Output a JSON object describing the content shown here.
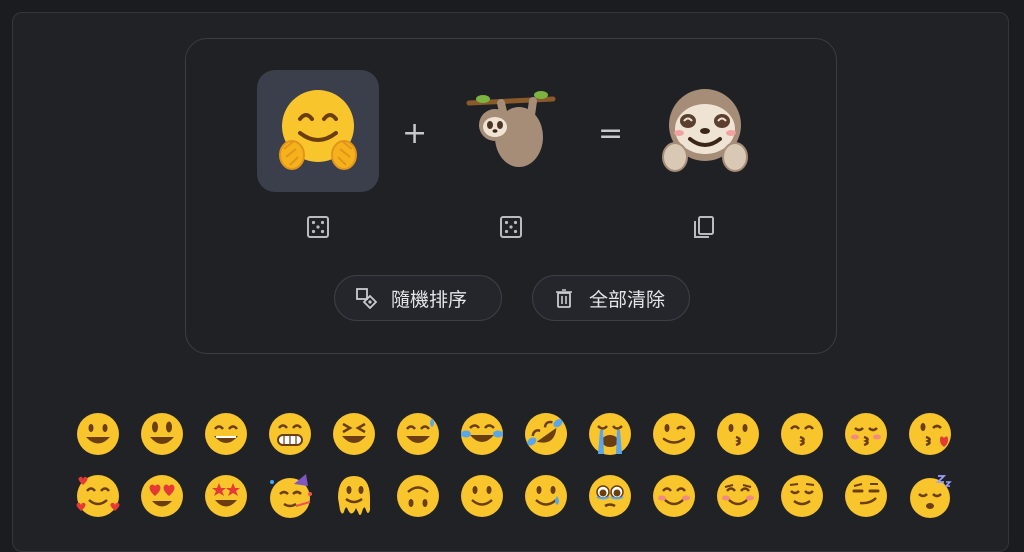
{
  "mixer": {
    "left_emoji": "hugging-face",
    "right_emoji": "sloth",
    "result_emoji": "hugging-sloth",
    "plus_symbol": "+",
    "equals_symbol": "=",
    "left_tool_icon": "dice-icon",
    "right_tool_icon": "dice-icon",
    "result_tool_icon": "copy-icon"
  },
  "actions": {
    "shuffle_label": "隨機排序",
    "shuffle_icon": "shuffle-shapes-icon",
    "clear_label": "全部清除",
    "clear_icon": "trash-icon"
  },
  "emoji_grid": {
    "row1": [
      "grinning-face",
      "grinning-face-big-eyes",
      "grinning-face-smiling-eyes",
      "beaming-face",
      "grinning-squinting-face",
      "grinning-face-sweat",
      "face-tears-of-joy",
      "rolling-on-floor-laughing",
      "loudly-crying-face",
      "winking-face",
      "kissing-face",
      "kissing-face-smiling-eyes",
      "kissing-face-closed-eyes",
      "face-blowing-kiss"
    ],
    "row2": [
      "smiling-face-hearts",
      "heart-eyes",
      "star-struck",
      "partying-face",
      "melting-face",
      "upside-down-face",
      "slightly-smiling-face",
      "smiling-face-tear",
      "face-holding-back-tears",
      "smiling-face-smiling-eyes",
      "smiling-face",
      "relieved-face",
      "smirking-face",
      "sleeping-face"
    ]
  },
  "colors": {
    "background": "#1b1c20",
    "panel": "#212226",
    "card_border": "#3b3d44",
    "selected_slot": "#3a3f4b",
    "emoji_yellow": "#f9c52c",
    "text": "#e4e5e8"
  }
}
